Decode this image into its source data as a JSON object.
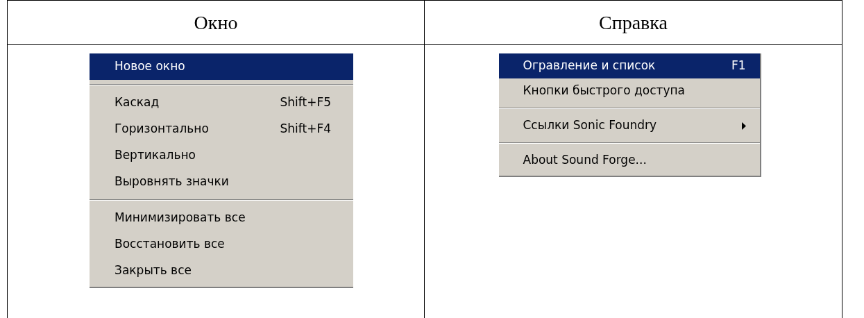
{
  "columns": [
    {
      "heading": "Окно",
      "menu": [
        {
          "kind": "item",
          "label": "Новое окно",
          "selected": true
        },
        {
          "kind": "separator"
        },
        {
          "kind": "item",
          "label": "Каскад",
          "shortcut": "Shift+F5",
          "selected": false
        },
        {
          "kind": "item",
          "label": "Горизонтально",
          "shortcut": "Shift+F4",
          "selected": false
        },
        {
          "kind": "item",
          "label": "Вертикально",
          "selected": false
        },
        {
          "kind": "item",
          "label": "Выровнять значки",
          "selected": false
        },
        {
          "kind": "separator"
        },
        {
          "kind": "item",
          "label": "Минимизировать все",
          "selected": false
        },
        {
          "kind": "item",
          "label": "Восстановить все",
          "selected": false
        },
        {
          "kind": "item",
          "label": "Закрыть все",
          "selected": false
        }
      ]
    },
    {
      "heading": "Справка",
      "menu": [
        {
          "kind": "item",
          "label": "Огравление и список",
          "shortcut": "F1",
          "selected": true
        },
        {
          "kind": "item",
          "label": "Кнопки быстрого доступа",
          "selected": false
        },
        {
          "kind": "separator"
        },
        {
          "kind": "item",
          "label": "Ссылки Sonic Foundry",
          "submenu": true,
          "selected": false
        },
        {
          "kind": "separator"
        },
        {
          "kind": "item",
          "label": "About Sound Forge...",
          "selected": false
        }
      ]
    }
  ]
}
